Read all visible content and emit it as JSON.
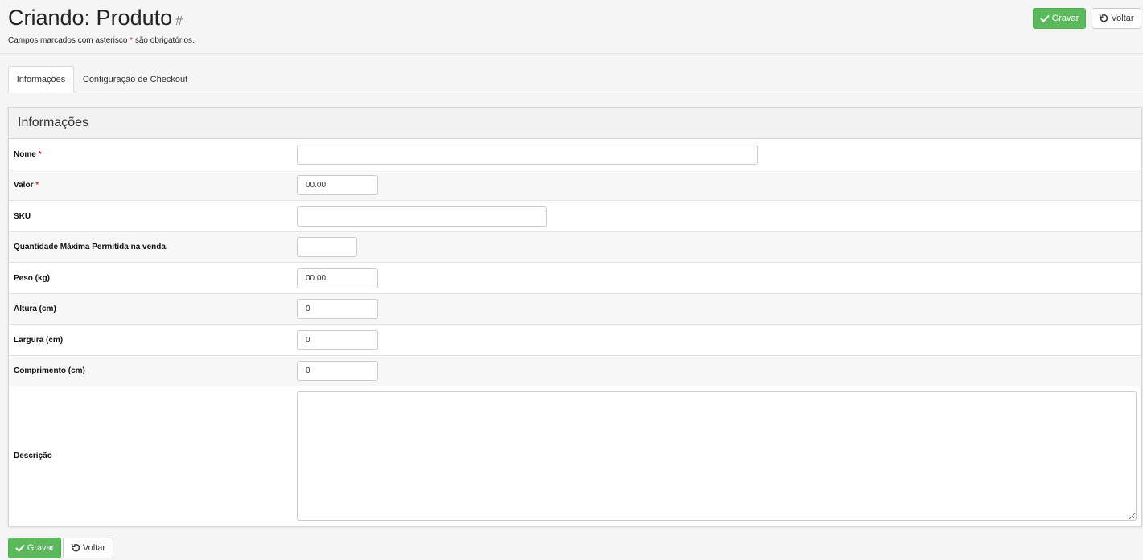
{
  "header": {
    "title": "Criando: Produto",
    "hash": "#",
    "subtitle_prefix": "Campos marcados com asterisco ",
    "subtitle_star": "*",
    "subtitle_suffix": " são obrigatórios.",
    "save_label": "Gravar",
    "back_label": "Voltar"
  },
  "tabs": [
    {
      "label": "Informações",
      "active": true
    },
    {
      "label": "Configuração de Checkout",
      "active": false
    }
  ],
  "panel": {
    "title": "Informações",
    "fields": [
      {
        "label": "Nome",
        "required": true,
        "value": ""
      },
      {
        "label": "Valor",
        "required": true,
        "value": "00.00"
      },
      {
        "label": "SKU",
        "required": false,
        "value": ""
      },
      {
        "label": "Quantidade Máxima Permitida na venda.",
        "required": false,
        "value": ""
      },
      {
        "label": "Peso (kg)",
        "required": false,
        "value": "00.00"
      },
      {
        "label": "Altura (cm)",
        "required": false,
        "value": "0"
      },
      {
        "label": "Largura (cm)",
        "required": false,
        "value": "0"
      },
      {
        "label": "Comprimento (cm)",
        "required": false,
        "value": "0"
      },
      {
        "label": "Descrição",
        "required": false,
        "value": ""
      }
    ],
    "required_marker": "*"
  },
  "footer": {
    "save_label": "Gravar",
    "back_label": "Voltar"
  },
  "colors": {
    "success": "#5cb85c",
    "required": "#c9302c"
  },
  "icons": {
    "save": "check-icon",
    "back": "undo-icon"
  }
}
